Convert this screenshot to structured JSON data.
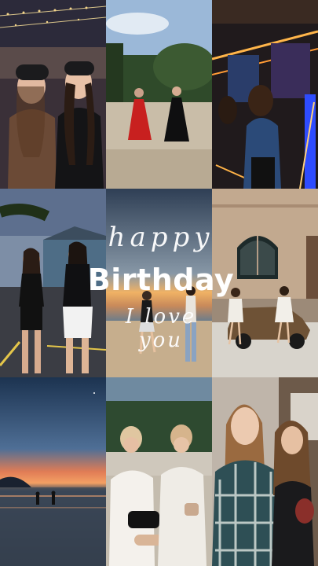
{
  "overlay_text": {
    "line1": "happy",
    "line2": "Birthday",
    "line3": "I love you"
  },
  "photos": [
    {
      "id": "friends-night-market"
    },
    {
      "id": "dresses-garden"
    },
    {
      "id": "neon-arcade"
    },
    {
      "id": "street-outfits"
    },
    {
      "id": "beach-sunset"
    },
    {
      "id": "vintage-car-building"
    },
    {
      "id": "ocean-sunset-silhouettes"
    },
    {
      "id": "white-blazers"
    },
    {
      "id": "plaid-coat-selfie"
    }
  ]
}
